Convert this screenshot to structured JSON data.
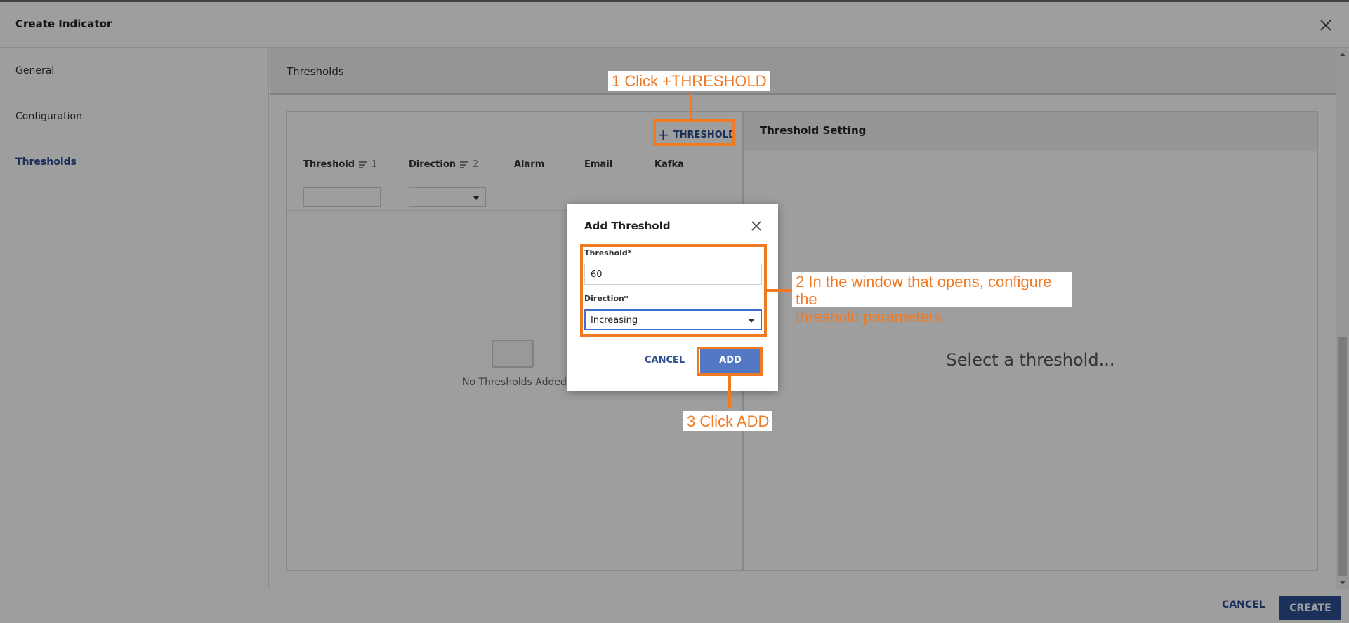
{
  "window": {
    "title": "Create Indicator"
  },
  "sidebar": {
    "items": [
      {
        "label": "General"
      },
      {
        "label": "Configuration"
      },
      {
        "label": "Thresholds"
      }
    ]
  },
  "section": {
    "title": "Thresholds"
  },
  "table": {
    "add_button": "THRESHOLD",
    "columns": [
      {
        "label": "Threshold",
        "sort_order": "1"
      },
      {
        "label": "Direction",
        "sort_order": "2"
      },
      {
        "label": "Alarm"
      },
      {
        "label": "Email"
      },
      {
        "label": "Kafka"
      }
    ],
    "empty_text": "No Thresholds Added"
  },
  "settings_panel": {
    "title": "Threshold Setting",
    "placeholder": "Select a threshold..."
  },
  "footer": {
    "cancel": "CANCEL",
    "create": "CREATE"
  },
  "dialog": {
    "title": "Add Threshold",
    "threshold_label": "Threshold*",
    "threshold_value": "60",
    "direction_label": "Direction*",
    "direction_value": "Increasing",
    "cancel": "CANCEL",
    "add": "ADD"
  },
  "annotations": {
    "step1": "1 Click +THRESHOLD",
    "step2_line1": "2 In the window that opens, configure the",
    "step2_line2": "threshold parameters",
    "step3": "3 Click ADD"
  },
  "colors": {
    "accent": "#2c4f91",
    "annotation": "#f07a24",
    "primary_button": "#5479c4"
  }
}
